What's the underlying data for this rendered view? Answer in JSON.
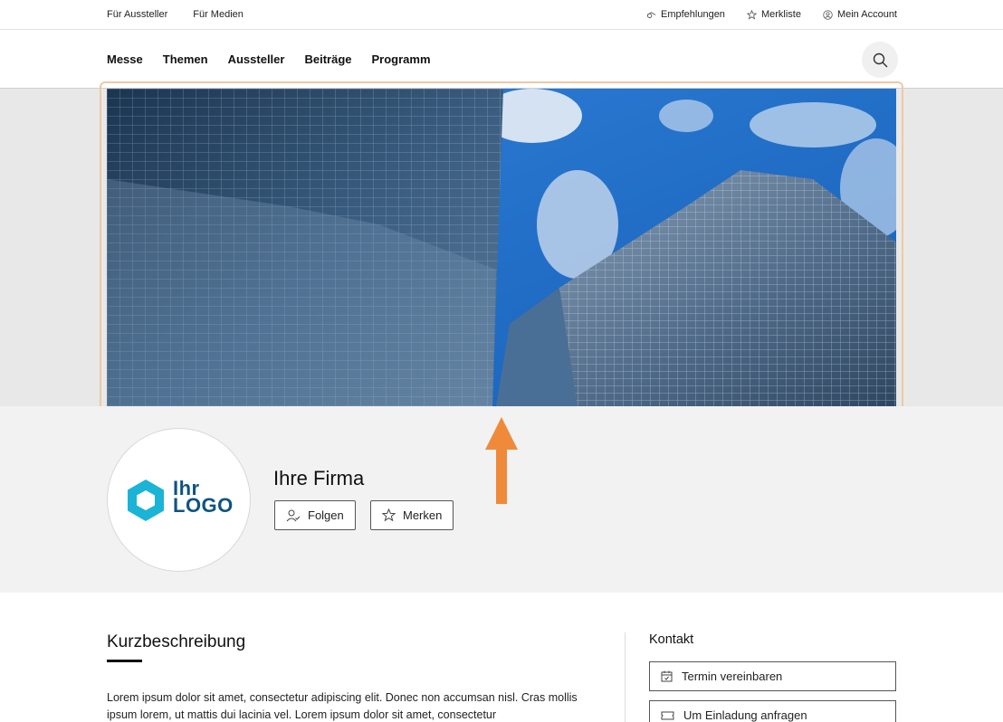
{
  "util_nav": {
    "left": [
      "Für Aussteller",
      "Für Medien"
    ],
    "recommendations": "Empfehlungen",
    "watchlist": "Merkliste",
    "account": "Mein Account"
  },
  "main_nav": {
    "items": [
      "Messe",
      "Themen",
      "Aussteller",
      "Beiträge",
      "Programm"
    ]
  },
  "profile": {
    "logo_line1": "Ihr",
    "logo_line2": "LOGO",
    "company_name": "Ihre Firma",
    "follow_label": "Folgen",
    "bookmark_label": "Merken"
  },
  "description": {
    "title": "Kurzbeschreibung",
    "text": "Lorem ipsum dolor sit amet, consectetur adipiscing elit. Donec non accumsan nisl. Cras mollis ipsum lorem, ut mattis dui lacinia vel. Lorem ipsum dolor sit amet, consectetur"
  },
  "contact": {
    "title": "Kontakt",
    "appointment_label": "Termin vereinbaren",
    "invitation_label": "Um Einladung anfragen"
  },
  "colors": {
    "accent_arrow": "#ef8a3a",
    "logo_cyan": "#1bb3d6",
    "logo_navy": "#0e5480",
    "hero_frame": "#f0c8a4"
  }
}
